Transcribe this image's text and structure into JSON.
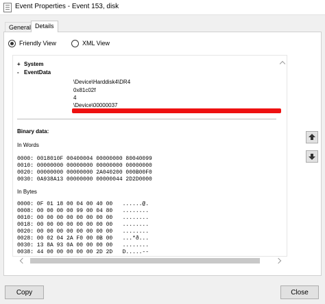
{
  "window": {
    "title": "Event Properties - Event 153, disk",
    "icon": "event-log-icon"
  },
  "tabs": [
    {
      "label": "General",
      "active": false
    },
    {
      "label": "Details",
      "active": true
    }
  ],
  "view_options": [
    {
      "label": "Friendly View",
      "selected": true
    },
    {
      "label": "XML View",
      "selected": false
    }
  ],
  "tree": {
    "system": {
      "sign": "+",
      "label": "System"
    },
    "eventdata": {
      "sign": "-",
      "label": "EventData"
    }
  },
  "eventdata_values": [
    "\\Device\\Harddisk4\\DR4",
    "0x81c02f",
    "4",
    "\\Device\\00000037"
  ],
  "binary": {
    "heading": "Binary data:",
    "words_label": "In Words",
    "words": [
      "0000: 0018010F 00400004 00000000 80040099",
      "0010: 00000000 00000000 00000000 00000000",
      "0020: 00000000 00000000 2A040200 000B00F0",
      "0030: 0A938A13 00000000 00000044 2D2D0000"
    ],
    "bytes_label": "In Bytes",
    "bytes": [
      "0000: 0F 01 18 00 04 00 40 00   ......@.",
      "0008: 00 00 00 00 99 00 04 80   ........",
      "0010: 00 00 00 00 00 00 00 00   ........",
      "0018: 00 00 00 00 00 00 00 00   ........",
      "0020: 00 00 00 00 00 00 00 00   ........",
      "0028: 00 02 04 2A F0 00 0B 00   ...*ð...",
      "0030: 13 8A 93 0A 00 00 00 00   ........",
      "0038: 44 00 00 00 00 00 2D 2D   D.....--"
    ]
  },
  "buttons": {
    "copy": "Copy",
    "close": "Close"
  },
  "colors": {
    "redaction": "#ee1111",
    "window_bg": "#f0f0f0",
    "panel_bg": "#ffffff"
  }
}
